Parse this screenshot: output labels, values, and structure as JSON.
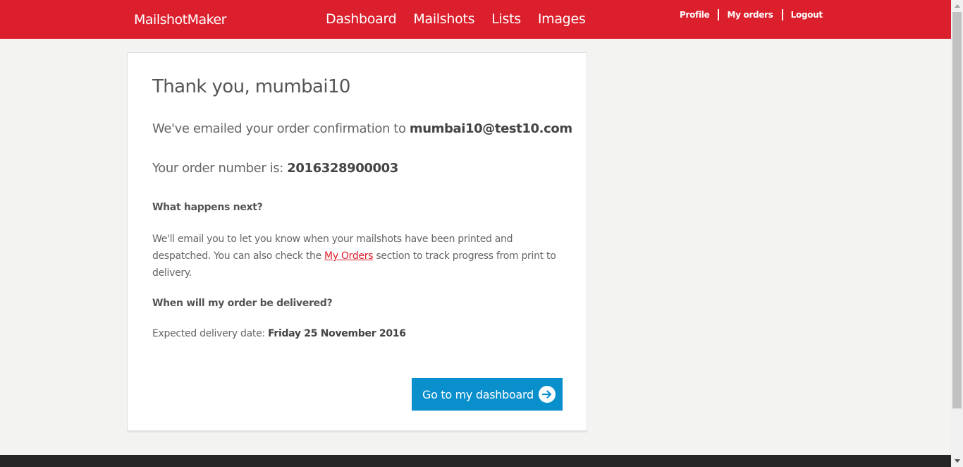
{
  "header": {
    "logo": "MailshotMaker",
    "nav": [
      "Dashboard",
      "Mailshots",
      "Lists",
      "Images"
    ],
    "user_nav": [
      "Profile",
      "My orders",
      "Logout"
    ],
    "color": "#dc1f2c"
  },
  "confirmation": {
    "title": "Thank you, mumbai10",
    "email_prefix": "We've emailed your order confirmation to ",
    "email": "mumbai10@test10.com",
    "order_prefix": "Your order number is: ",
    "order_number": "2016328900003",
    "next_heading": "What happens next?",
    "next_text_before": "We'll email you to let  you know when your mailshots have been printed and despatched. You can also check the ",
    "next_link": "My Orders",
    "next_text_after": " section to track progress from print to delivery.",
    "delivery_heading": "When will my order be delivered?",
    "delivery_prefix": "Expected delivery date: ",
    "delivery_date": "Friday 25 November 2016",
    "button_label": "Go to my dashboard",
    "button_color": "#0a8fcd",
    "button_icon": "arrow-right-circle-icon"
  }
}
